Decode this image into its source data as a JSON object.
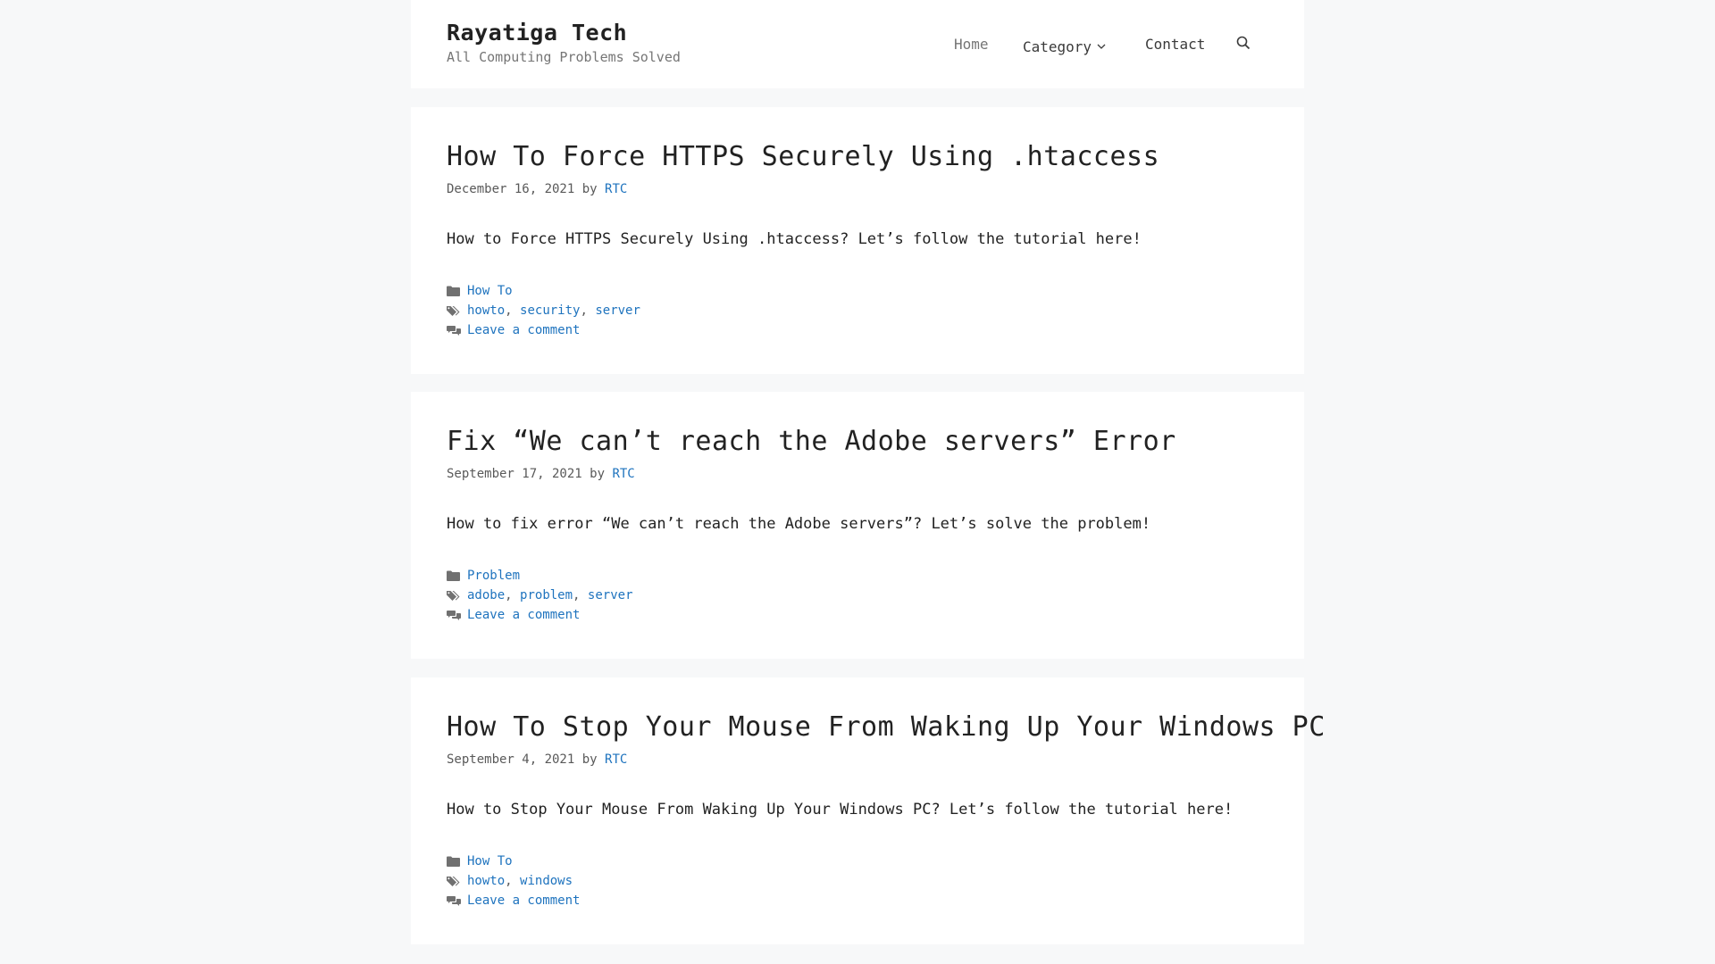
{
  "site": {
    "title": "Rayatiga Tech",
    "description": "All Computing Problems Solved"
  },
  "nav": {
    "home": "Home",
    "category": "Category",
    "contact": "Contact",
    "search_icon": "search-icon"
  },
  "labels": {
    "by": "by",
    "comma": ","
  },
  "posts": [
    {
      "title": "How To Force HTTPS Securely Using .htaccess",
      "date": "December 16, 2021",
      "author": "RTC",
      "excerpt": "How to Force HTTPS Securely Using .htaccess? Let’s follow the tutorial here!",
      "category": "How To",
      "tags": [
        "howto",
        "security",
        "server"
      ],
      "comment_link": "Leave a comment"
    },
    {
      "title": "Fix “We can’t reach the Adobe servers” Error",
      "date": "September 17, 2021",
      "author": "RTC",
      "excerpt": "How to fix error “We can’t reach the Adobe servers”? Let’s solve the problem!",
      "category": "Problem",
      "tags": [
        "adobe",
        "problem",
        "server"
      ],
      "comment_link": "Leave a comment"
    },
    {
      "title": "How To Stop Your Mouse From Waking Up Your Windows PC",
      "date": "September 4, 2021",
      "author": "RTC",
      "excerpt": "How to Stop Your Mouse From Waking Up Your Windows PC? Let’s follow the tutorial here!",
      "category": "How To",
      "tags": [
        "howto",
        "windows"
      ],
      "comment_link": "Leave a comment"
    }
  ],
  "colors": {
    "background": "#f7f8f9",
    "link": "#1e73be",
    "text": "#222222",
    "muted": "#757575"
  }
}
